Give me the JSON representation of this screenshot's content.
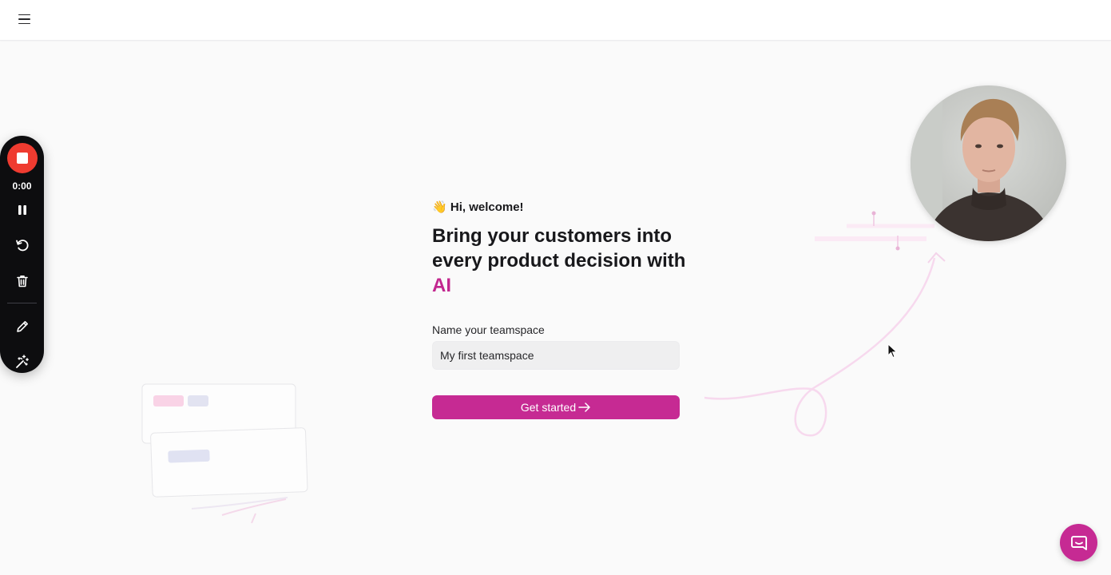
{
  "nav": {
    "menu_icon": "hamburger-menu-icon"
  },
  "recorder": {
    "elapsed": "0:00",
    "icons": [
      "stop-icon",
      "pause-icon",
      "restart-icon",
      "trash-icon",
      "pencil-icon",
      "sparkle-wand-icon"
    ]
  },
  "onboarding": {
    "greeting_emoji": "👋",
    "greeting": "Hi, welcome!",
    "headline_main": "Bring your customers into every product decision with ",
    "headline_accent": "AI",
    "field_label": "Name your teamspace",
    "field_value": "My first teamspace",
    "cta_label": "Get started",
    "cta_icon": "arrow-right-icon"
  },
  "chat": {
    "icon": "chat-bubble-icon"
  },
  "colors": {
    "accent": "#c62a93",
    "record_red": "#ef3b30",
    "toolbar_bg": "#0d0d0f",
    "page_bg": "#fafafa"
  }
}
